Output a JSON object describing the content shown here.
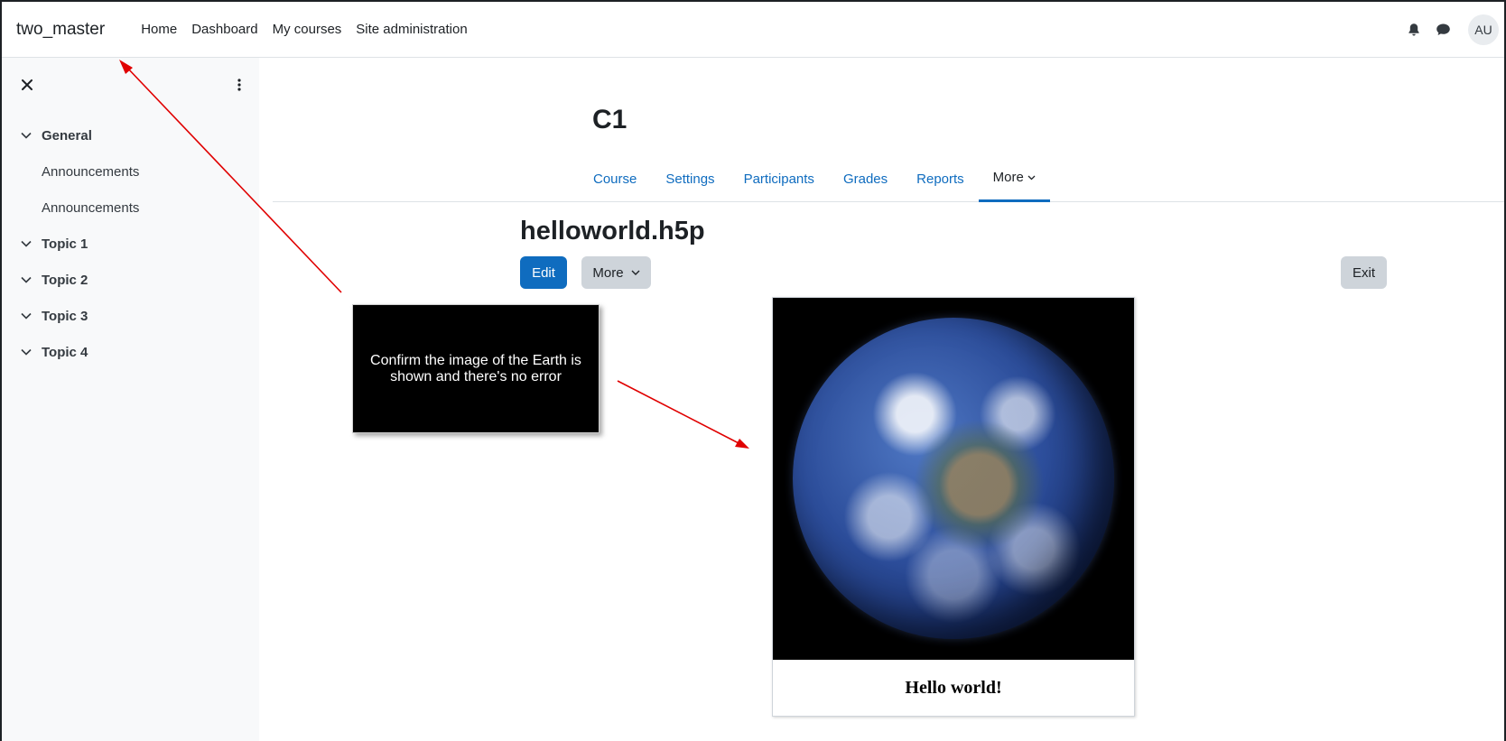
{
  "navbar": {
    "brand": "two_master",
    "links": [
      "Home",
      "Dashboard",
      "My courses",
      "Site administration"
    ],
    "icons": [
      "bell-icon",
      "chat-icon"
    ],
    "avatar_initials": "AU"
  },
  "drawer": {
    "close_icon": "close-icon",
    "menu_icon": "kebab-icon",
    "sections": [
      {
        "label": "General",
        "items": [
          "Announcements",
          "Announcements"
        ]
      },
      {
        "label": "Topic 1",
        "items": []
      },
      {
        "label": "Topic 2",
        "items": []
      },
      {
        "label": "Topic 3",
        "items": []
      },
      {
        "label": "Topic 4",
        "items": []
      }
    ]
  },
  "course": {
    "title": "C1",
    "tabs": [
      "Course",
      "Settings",
      "Participants",
      "Grades",
      "Reports",
      "More"
    ],
    "active_tab": "More"
  },
  "activity": {
    "title": "helloworld.h5p",
    "edit_label": "Edit",
    "more_label": "More",
    "exit_label": "Exit"
  },
  "callout": {
    "text": "Confirm the image of the Earth is shown and there's no error"
  },
  "h5p": {
    "caption": "Hello world!"
  },
  "colors": {
    "primary": "#0f6cbf",
    "text": "#1d2125",
    "drawer_bg": "#f8f9fa",
    "secondary_btn": "#ced4da",
    "annotation": "#e00000"
  }
}
